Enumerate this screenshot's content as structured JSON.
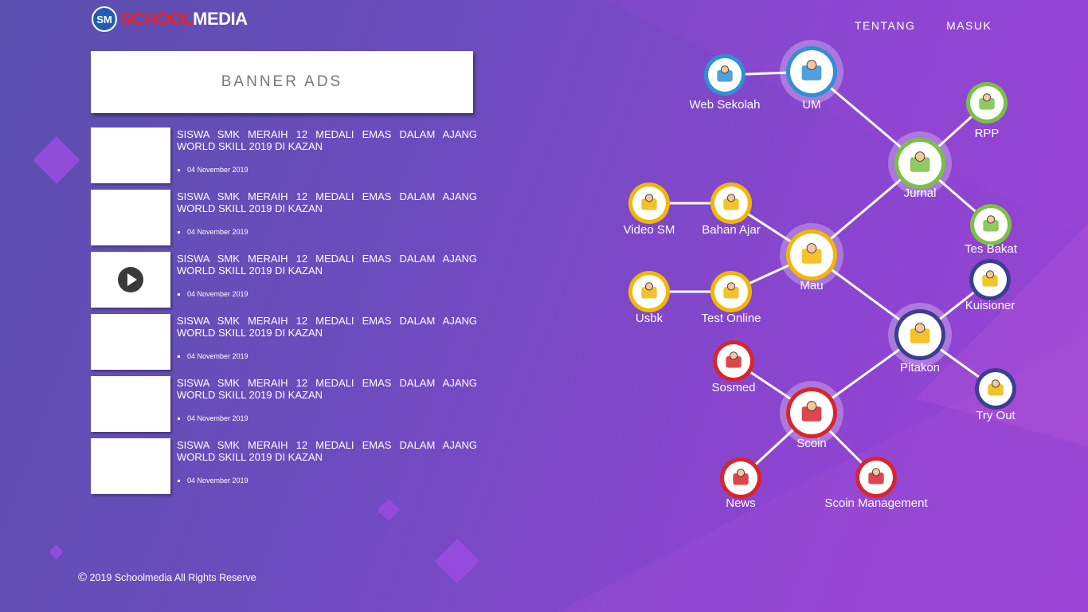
{
  "header": {
    "logo_badge": "SM",
    "logo_part1": "SCHOOL",
    "logo_part2": "MEDIA",
    "nav": [
      "TENTANG",
      "MASUK"
    ]
  },
  "banner": {
    "label": "BANNER ADS"
  },
  "news": [
    {
      "title": "SISWA SMK MERAIH 12 MEDALI EMAS DALAM AJANG WORLD SKILL 2019 DI KAZAN",
      "date": "04 November 2019",
      "has_video": false
    },
    {
      "title": "SISWA SMK MERAIH 12 MEDALI EMAS DALAM AJANG WORLD SKILL 2019 DI KAZAN",
      "date": "04 November 2019",
      "has_video": false
    },
    {
      "title": "SISWA SMK MERAIH 12 MEDALI EMAS DALAM AJANG WORLD SKILL 2019 DI KAZAN",
      "date": "04 November 2019",
      "has_video": true
    },
    {
      "title": "SISWA SMK MERAIH 12 MEDALI EMAS DALAM AJANG WORLD SKILL 2019 DI KAZAN",
      "date": "04 November 2019",
      "has_video": false
    },
    {
      "title": "SISWA SMK MERAIH 12 MEDALI EMAS DALAM AJANG WORLD SKILL 2019 DI KAZAN",
      "date": "04 November 2019",
      "has_video": false
    },
    {
      "title": "SISWA SMK MERAIH 12 MEDALI EMAS DALAM AJANG WORLD SKILL 2019 DI KAZAN",
      "date": "04 November 2019",
      "has_video": false
    }
  ],
  "footer": {
    "copyright_symbol": "©",
    "text": "2019 Schoolmedia All Rights Reserve"
  },
  "menu_nodes": [
    {
      "id": "web-sekolah",
      "label": "Web Sekolah",
      "icon": "puzzle-icon",
      "ring": "#2f8fd8"
    },
    {
      "id": "um",
      "label": "UM",
      "icon": "magnifier-person-icon",
      "ring": "#2f8fd8"
    },
    {
      "id": "rpp",
      "label": "RPP",
      "icon": "desk-icon",
      "ring": "#7ac143"
    },
    {
      "id": "jurnal",
      "label": "Jurnal",
      "icon": "folder-search-icon",
      "ring": "#7ac143"
    },
    {
      "id": "tes-bakat",
      "label": "Tes Bakat",
      "icon": "brain-icon",
      "ring": "#7ac143"
    },
    {
      "id": "video-sm",
      "label": "Video SM",
      "icon": "monitor-icon",
      "ring": "#f2b705"
    },
    {
      "id": "bahan-ajar",
      "label": "Bahan Ajar",
      "icon": "document-star-icon",
      "ring": "#f2b705"
    },
    {
      "id": "mau",
      "label": "Mau",
      "icon": "book-icon",
      "ring": "#f2b705"
    },
    {
      "id": "usbk",
      "label": "Usbk",
      "icon": "student-icon",
      "ring": "#f2b705"
    },
    {
      "id": "test-online",
      "label": "Test Online",
      "icon": "laptop-person-icon",
      "ring": "#f2b705"
    },
    {
      "id": "kuisioner",
      "label": "Kuisioner",
      "icon": "clipboard-icon",
      "ring": "#3a3f8f"
    },
    {
      "id": "pitakon",
      "label": "Pitakon",
      "icon": "question-box-icon",
      "ring": "#3a3f8f"
    },
    {
      "id": "try-out",
      "label": "Try Out",
      "icon": "exam-person-icon",
      "ring": "#3a3f8f"
    },
    {
      "id": "sosmed",
      "label": "Sosmed",
      "icon": "people-chat-icon",
      "ring": "#d8252d"
    },
    {
      "id": "scoin",
      "label": "Scoin",
      "icon": "coin-hand-icon",
      "ring": "#d8252d"
    },
    {
      "id": "news",
      "label": "News",
      "icon": "newsreader-icon",
      "ring": "#d8252d"
    },
    {
      "id": "scoin-management",
      "label": "Scoin Management",
      "icon": "chart-search-icon",
      "ring": "#d8252d"
    }
  ]
}
